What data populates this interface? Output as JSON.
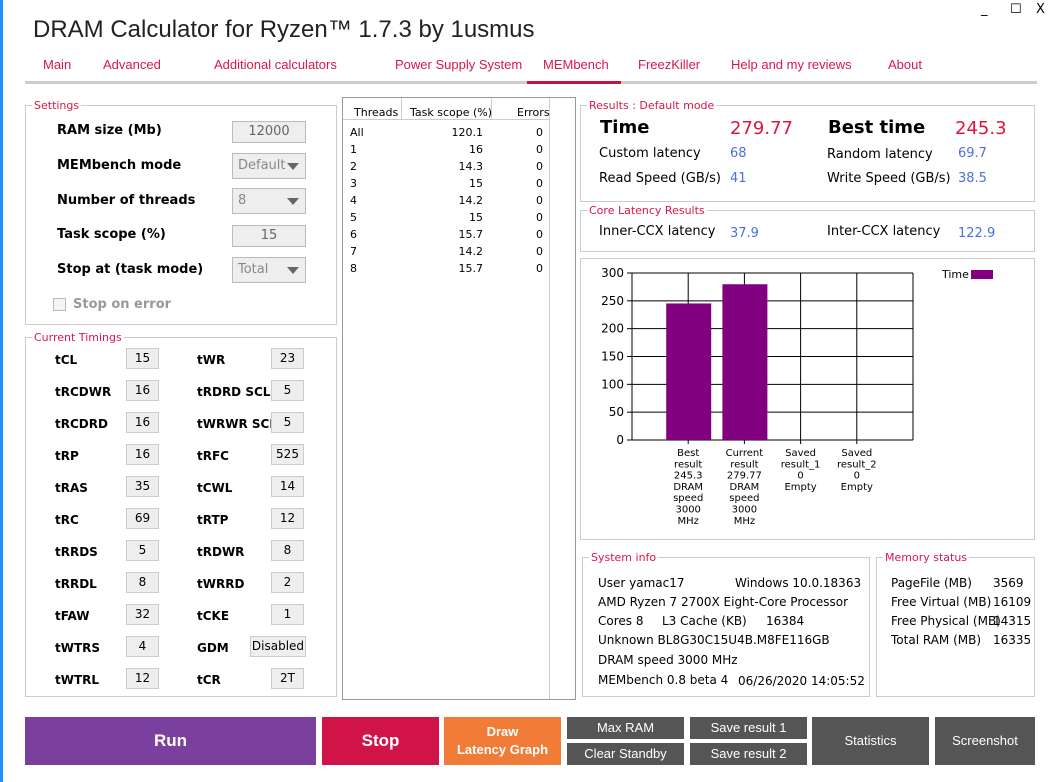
{
  "window": {
    "title": "DRAM Calculator for Ryzen™ 1.7.3 by 1usmus",
    "minimize": "_",
    "maximize": "☐",
    "close": "X"
  },
  "tabs": [
    {
      "label": "Main"
    },
    {
      "label": "Advanced"
    },
    {
      "label": "Additional calculators"
    },
    {
      "label": "Power Supply System"
    },
    {
      "label": "MEMbench",
      "active": true
    },
    {
      "label": "FreezKiller"
    },
    {
      "label": "Help and my reviews"
    },
    {
      "label": "About"
    }
  ],
  "colors": {
    "accent": "#d9174a",
    "run": "#7b3f9e",
    "stop": "#d11447",
    "draw": "#f07c37",
    "gray_button": "#555555",
    "bar": "#800080",
    "value_blue": "#4a6fe0"
  },
  "settings": {
    "legend": "Settings",
    "ram_size_label": "RAM size (Mb)",
    "ram_size": "12000",
    "mode_label": "MEMbench mode",
    "mode": "Default",
    "threads_label": "Number of threads",
    "threads": "8",
    "task_scope_label": "Task scope (%)",
    "task_scope": "15",
    "stop_at_label": "Stop at (task mode)",
    "stop_at": "Total",
    "stop_on_error_label": "Stop on error",
    "stop_on_error": false
  },
  "timings": {
    "legend": "Current Timings",
    "rows": [
      [
        {
          "l": "tCL",
          "v": "15"
        },
        {
          "l": "tWR",
          "v": "23"
        }
      ],
      [
        {
          "l": "tRCDWR",
          "v": "16"
        },
        {
          "l": "tRDRD SCL",
          "v": "5"
        }
      ],
      [
        {
          "l": "tRCDRD",
          "v": "16"
        },
        {
          "l": "tWRWR SCL",
          "v": "5"
        }
      ],
      [
        {
          "l": "tRP",
          "v": "16"
        },
        {
          "l": "tRFC",
          "v": "525"
        }
      ],
      [
        {
          "l": "tRAS",
          "v": "35"
        },
        {
          "l": "tCWL",
          "v": "14"
        }
      ],
      [
        {
          "l": "tRC",
          "v": "69"
        },
        {
          "l": "tRTP",
          "v": "12"
        }
      ],
      [
        {
          "l": "tRRDS",
          "v": "5"
        },
        {
          "l": "tRDWR",
          "v": "8"
        }
      ],
      [
        {
          "l": "tRRDL",
          "v": "8"
        },
        {
          "l": "tWRRD",
          "v": "2"
        }
      ],
      [
        {
          "l": "tFAW",
          "v": "32"
        },
        {
          "l": "tCKE",
          "v": "1"
        }
      ],
      [
        {
          "l": "tWTRS",
          "v": "4"
        },
        {
          "l": "GDM",
          "v": "Disabled"
        }
      ],
      [
        {
          "l": "tWTRL",
          "v": "12"
        },
        {
          "l": "tCR",
          "v": "2T"
        }
      ]
    ]
  },
  "threads_table": {
    "headers": [
      "Threads",
      "Task scope (%)",
      "Errors"
    ],
    "rows": [
      [
        "All",
        "120.1",
        "0"
      ],
      [
        "1",
        "16",
        "0"
      ],
      [
        "2",
        "14.3",
        "0"
      ],
      [
        "3",
        "15",
        "0"
      ],
      [
        "4",
        "14.2",
        "0"
      ],
      [
        "5",
        "15",
        "0"
      ],
      [
        "6",
        "15.7",
        "0"
      ],
      [
        "7",
        "14.2",
        "0"
      ],
      [
        "8",
        "15.7",
        "0"
      ]
    ]
  },
  "results": {
    "legend": "Results : Default mode",
    "time_label": "Time",
    "time": "279.77",
    "best_label": "Best time",
    "best": "245.3",
    "custom_latency_label": "Custom latency",
    "custom_latency": "68",
    "random_latency_label": "Random latency",
    "random_latency": "69.7",
    "read_label": "Read Speed (GB/s)",
    "read": "41",
    "write_label": "Write Speed (GB/s)",
    "write": "38.5"
  },
  "core_latency": {
    "legend": "Core Latency Results",
    "inner_label": "Inner-CCX latency",
    "inner": "37.9",
    "inter_label": "Inter-CCX latency",
    "inter": "122.9"
  },
  "chart_data": {
    "type": "bar",
    "ylim": [
      0,
      300
    ],
    "yticks": [
      "0",
      "50",
      "100",
      "150",
      "200",
      "250",
      "300"
    ],
    "grid": true,
    "legend_position": "top-right",
    "categories": [
      "Best\nresult\n245.3\nDRAM\nspeed\n3000\nMHz",
      "Current\nresult\n279.77\nDRAM\nspeed\n3000\nMHz",
      "Saved\nresult_1\n0\nEmpty",
      "Saved\nresult_2\n0\nEmpty"
    ],
    "series": [
      {
        "name": "Time",
        "values": [
          245.3,
          279.77,
          0,
          0
        ],
        "color": "#800080"
      }
    ]
  },
  "system_info": {
    "legend": "System info",
    "user": "User yamac17",
    "os": "Windows 10.0.18363",
    "cpu": "AMD Ryzen 7 2700X Eight-Core Processor",
    "cores": "Cores 8",
    "l3_label": "L3 Cache (KB)",
    "l3": "16384",
    "ram": "Unknown BL8G30C15U4B.M8FE116GB",
    "dram_speed": "DRAM speed 3000 MHz",
    "version": "MEMbench 0.8 beta 4",
    "datetime": "06/26/2020 14:05:52"
  },
  "memory_status": {
    "legend": "Memory status",
    "rows": [
      [
        "PageFile (MB)",
        "3569"
      ],
      [
        "Free Virtual (MB)",
        "16109"
      ],
      [
        "Free Physical (MB)",
        "14315"
      ],
      [
        "Total RAM (MB)",
        "16335"
      ]
    ]
  },
  "buttons": {
    "run": "Run",
    "stop": "Stop",
    "draw_line1": "Draw",
    "draw_line2": "Latency Graph",
    "max_ram": "Max RAM",
    "clear_standby": "Clear Standby",
    "save1": "Save result 1",
    "save2": "Save result 2",
    "statistics": "Statistics",
    "screenshot": "Screenshot"
  }
}
